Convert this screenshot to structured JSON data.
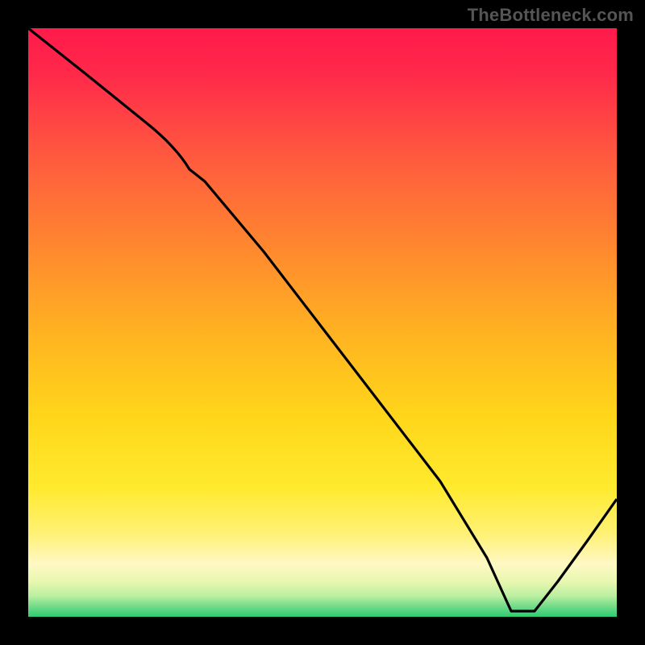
{
  "watermark": "TheBottleneck.com",
  "annotation_on_line": "",
  "colors": {
    "bg": "#000000",
    "grad_top": "#ff1744",
    "grad_mid1": "#ff7043",
    "grad_mid2": "#ffb300",
    "grad_mid3": "#ffeb3b",
    "grad_low": "#fff59d",
    "grad_green_light": "#c6f68d",
    "grad_green": "#2ecc71",
    "line": "#000000"
  },
  "chart_data": {
    "type": "line",
    "title": "",
    "xlabel": "",
    "ylabel": "",
    "xlim": [
      0,
      100
    ],
    "ylim": [
      0,
      100
    ],
    "notes": "Vertical gradient background (red→orange→yellow→pale→green). Black curve descends from top-left to bottom near x≈82 then rises to the right edge. A small red label sits on the line near the valley.",
    "series": [
      {
        "name": "curve",
        "x": [
          0,
          10,
          20,
          25,
          30,
          40,
          50,
          60,
          70,
          78,
          82,
          86,
          90,
          95,
          100
        ],
        "y": [
          100,
          92,
          84,
          80,
          74,
          62,
          49,
          36,
          23,
          10,
          1,
          1,
          6,
          13,
          20
        ]
      }
    ],
    "annotation": {
      "x": 82,
      "y": 1,
      "text": ""
    }
  }
}
